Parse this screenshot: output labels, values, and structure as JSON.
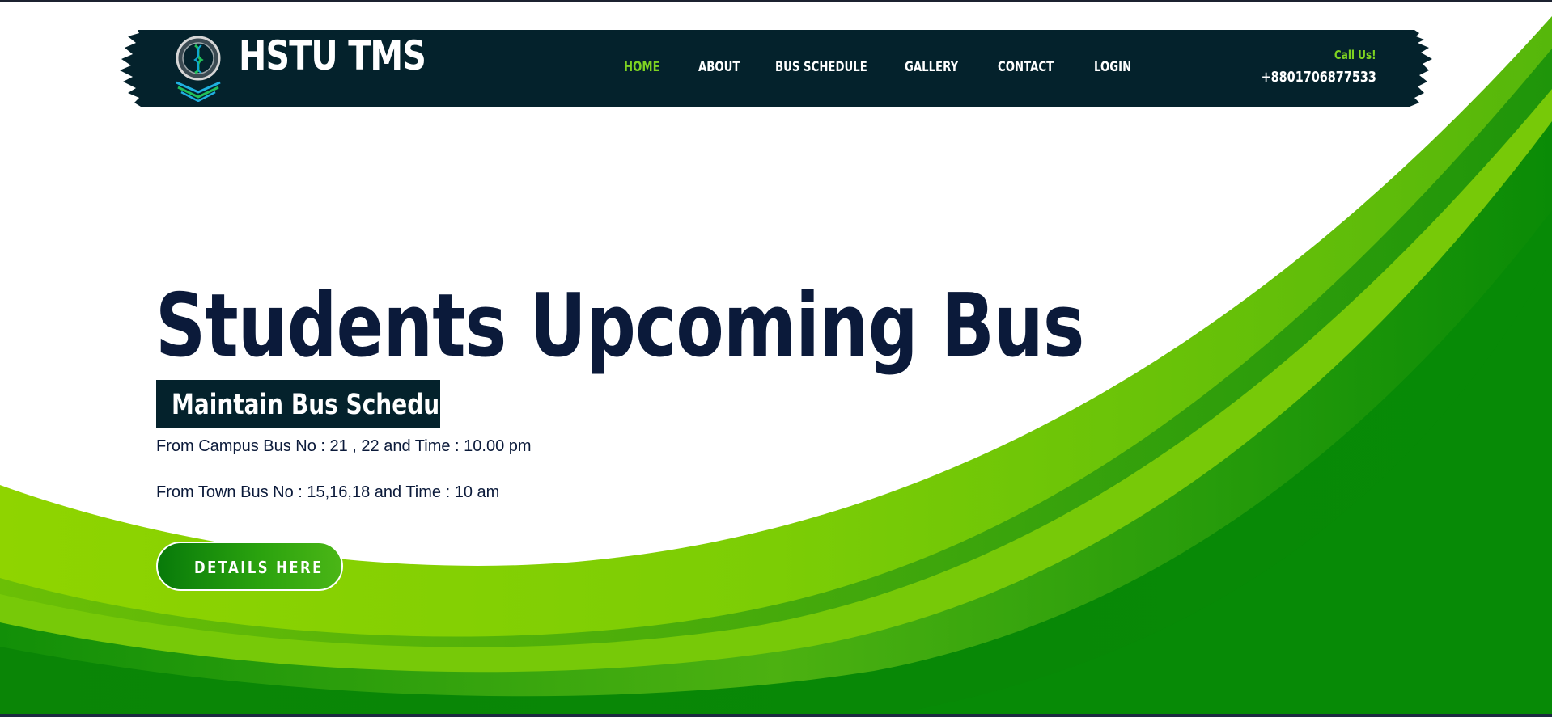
{
  "brand": {
    "name": "HSTU TMS",
    "logo_icon": "university-seal-icon"
  },
  "nav": {
    "items": [
      {
        "label": "HOME",
        "active": true
      },
      {
        "label": "ABOUT",
        "active": false
      },
      {
        "label": "BUS SCHEDULE",
        "active": false
      },
      {
        "label": "GALLERY",
        "active": false
      },
      {
        "label": "CONTACT",
        "active": false
      },
      {
        "label": "LOGIN",
        "active": false
      }
    ]
  },
  "contact": {
    "label": "Call Us!",
    "phone": "+8801706877533"
  },
  "hero": {
    "title": "Students Upcoming Bus",
    "badge": "Maintain Bus Schedule",
    "campus_line": "From Campus Bus No : 21 , 22 and Time : 10.00 pm",
    "town_line": "From Town Bus No : 15,16,18 and Time : 10 am",
    "cta_label": "DETAILS HERE"
  },
  "colors": {
    "header_bg": "#04222c",
    "accent": "#7ed321",
    "title": "#0b1a3a",
    "wave_dark": "#078a06",
    "wave_light": "#8fd400"
  }
}
